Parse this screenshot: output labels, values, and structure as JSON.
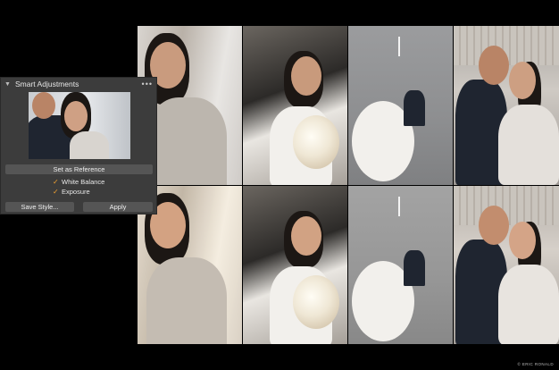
{
  "panel": {
    "title": "Smart Adjustments",
    "collapse_icon": "chevron-down-icon",
    "more_icon": "more-icon",
    "set_reference_label": "Set as Reference",
    "options": [
      {
        "label": "White Balance",
        "checked": true
      },
      {
        "label": "Exposure",
        "checked": true
      }
    ],
    "save_style_label": "Save Style...",
    "apply_label": "Apply",
    "accent_color": "#f0a030"
  },
  "credit": "© ERIC RONALD"
}
